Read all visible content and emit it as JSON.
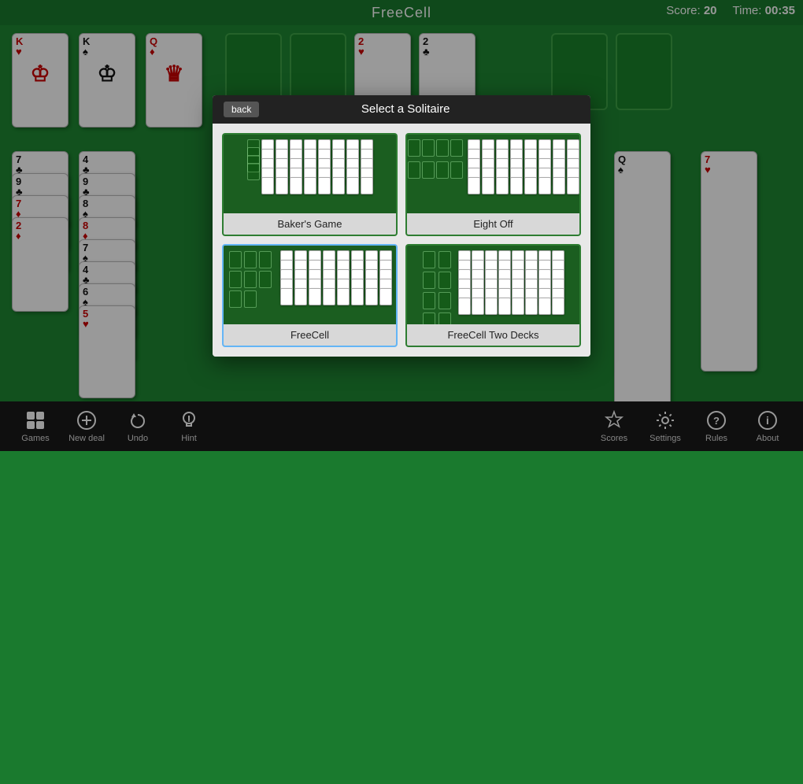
{
  "header": {
    "title": "FreeCell",
    "score_label": "Score:",
    "score_value": "20",
    "time_label": "Time:",
    "time_value": "00:35"
  },
  "modal": {
    "back_label": "back",
    "title": "Select a Solitaire",
    "options": [
      {
        "id": "bakers-game",
        "label": "Baker's Game",
        "selected": false
      },
      {
        "id": "eight-off",
        "label": "Eight Off",
        "selected": false
      },
      {
        "id": "freecell",
        "label": "FreeCell",
        "selected": true
      },
      {
        "id": "freecell-two-decks",
        "label": "FreeCell Two Decks",
        "selected": false
      }
    ]
  },
  "toolbar": {
    "left_buttons": [
      {
        "id": "games",
        "label": "Games",
        "icon": "⊞"
      },
      {
        "id": "new-deal",
        "label": "New deal",
        "icon": "⊕"
      },
      {
        "id": "undo",
        "label": "Undo",
        "icon": "↩"
      },
      {
        "id": "hint",
        "label": "Hint",
        "icon": "💡"
      }
    ],
    "right_buttons": [
      {
        "id": "scores",
        "label": "Scores",
        "icon": "♛"
      },
      {
        "id": "settings",
        "label": "Settings",
        "icon": "⚙"
      },
      {
        "id": "rules",
        "label": "Rules",
        "icon": "?"
      },
      {
        "id": "about",
        "label": "About",
        "icon": "ℹ"
      }
    ]
  }
}
